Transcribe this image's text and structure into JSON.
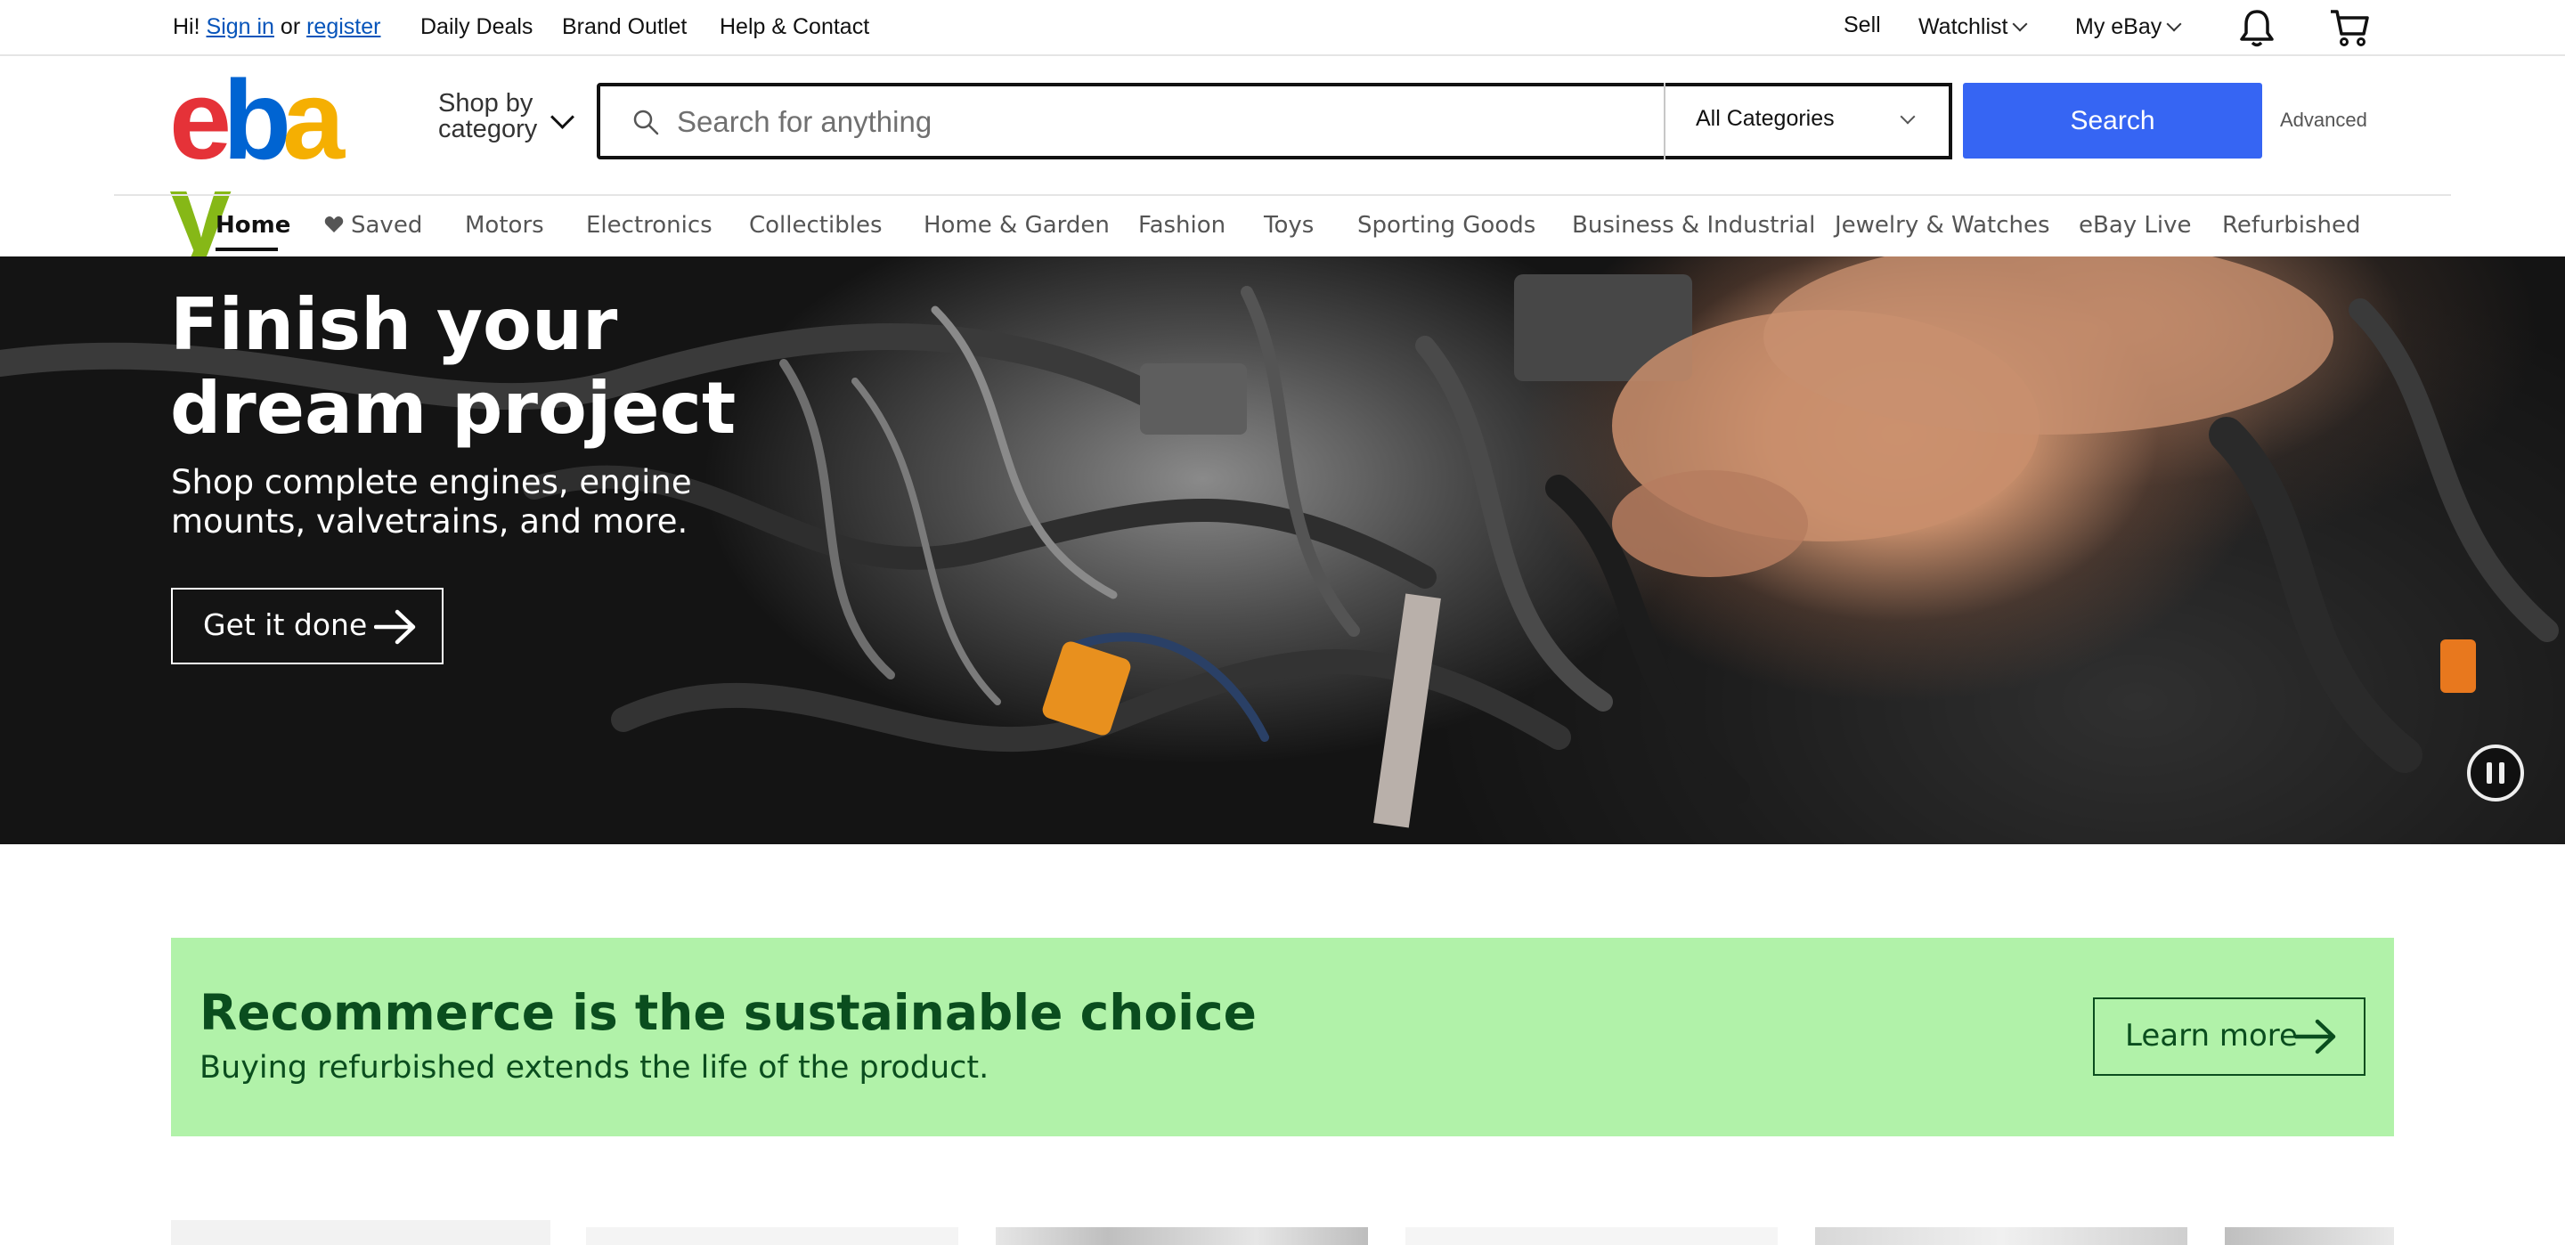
{
  "topbar": {
    "greeting": "Hi!",
    "sign_in": "Sign in",
    "or": "or",
    "register": "register",
    "daily_deals": "Daily Deals",
    "brand_outlet": "Brand Outlet",
    "help_contact": "Help & Contact",
    "sell": "Sell",
    "watchlist": "Watchlist",
    "my_ebay": "My eBay",
    "notification_icon": "bell-icon",
    "cart_icon": "cart-icon"
  },
  "header": {
    "logo_letters": [
      "e",
      "b",
      "a",
      "y"
    ],
    "logo_colors": [
      "#e53238",
      "#0064d2",
      "#f5af02",
      "#86b817"
    ],
    "shop_by_line1": "Shop by",
    "shop_by_line2": "category",
    "search_placeholder": "Search for anything",
    "category_selected": "All Categories",
    "search_button": "Search",
    "advanced": "Advanced",
    "accent_color": "#3665f3"
  },
  "nav": {
    "items": [
      {
        "label": "Home",
        "active": true
      },
      {
        "label": "Saved"
      },
      {
        "label": "Motors"
      },
      {
        "label": "Electronics"
      },
      {
        "label": "Collectibles"
      },
      {
        "label": "Home & Garden"
      },
      {
        "label": "Fashion"
      },
      {
        "label": "Toys"
      },
      {
        "label": "Sporting Goods"
      },
      {
        "label": "Business & Industrial"
      },
      {
        "label": "Jewelry & Watches"
      },
      {
        "label": "eBay Live"
      },
      {
        "label": "Refurbished"
      }
    ]
  },
  "hero": {
    "title": "Finish your\ndream project",
    "subtitle": "Shop complete engines, engine\nmounts, valvetrains, and more.",
    "cta": "Get it done",
    "pause_icon": "pause-icon"
  },
  "banner": {
    "title": "Recommerce is the sustainable choice",
    "subtitle": "Buying refurbished extends the life of the product.",
    "cta": "Learn more",
    "background": "#b1f2a9",
    "text_color": "#0a4d1e"
  }
}
